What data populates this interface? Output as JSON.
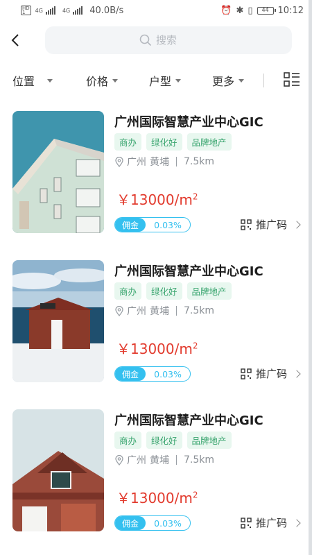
{
  "status_bar": {
    "network_a": "4G",
    "network_b": "4G",
    "speed": "40.0B/s",
    "battery": "44",
    "time": "10:12"
  },
  "header": {
    "search_placeholder": "搜索"
  },
  "filters": [
    {
      "label": "位置"
    },
    {
      "label": "价格"
    },
    {
      "label": "户型"
    },
    {
      "label": "更多"
    }
  ],
  "listings": [
    {
      "title": "广州国际智慧产业中心GIC",
      "tags": [
        "商办",
        "绿化好",
        "品牌地产"
      ],
      "city": "广州",
      "district": "黄埔",
      "distance": "7.5km",
      "price": "￥13000/m",
      "price_unit_sup": "2",
      "commission_label": "佣金",
      "commission_value": "0.03%",
      "promo_label": "推广码",
      "image": "apartment-building"
    },
    {
      "title": "广州国际智慧产业中心GIC",
      "tags": [
        "商办",
        "绿化好",
        "品牌地产"
      ],
      "city": "广州",
      "district": "黄埔",
      "distance": "7.5km",
      "price": "￥13000/m",
      "price_unit_sup": "2",
      "commission_label": "佣金",
      "commission_value": "0.03%",
      "promo_label": "推广码",
      "image": "red-cabin-by-sea"
    },
    {
      "title": "广州国际智慧产业中心GIC",
      "tags": [
        "商办",
        "绿化好",
        "品牌地产"
      ],
      "city": "广州",
      "district": "黄埔",
      "distance": "7.5km",
      "price": "￥13000/m",
      "price_unit_sup": "2",
      "commission_label": "佣金",
      "commission_value": "0.03%",
      "promo_label": "推广码",
      "image": "brick-house"
    }
  ]
}
